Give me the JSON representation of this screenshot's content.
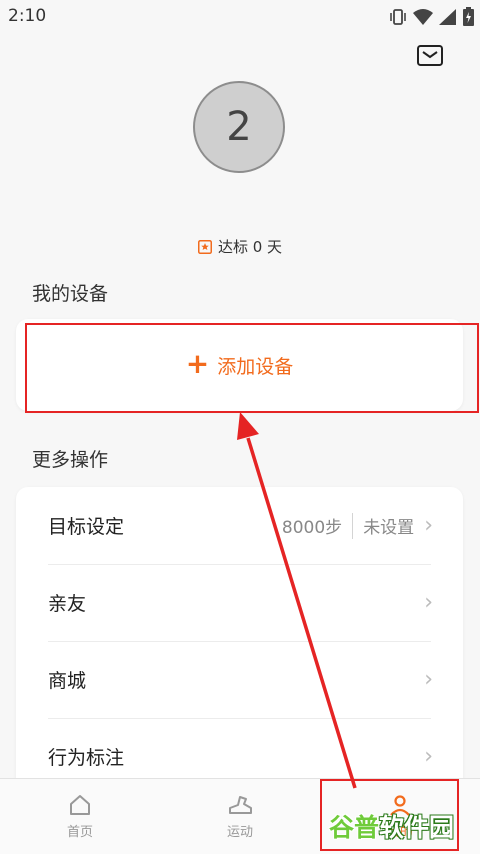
{
  "status_bar": {
    "time": "2:10",
    "icons": [
      "vibrate-icon",
      "wifi-icon",
      "signal-icon",
      "battery-icon"
    ]
  },
  "profile": {
    "avatar_text": "2",
    "goal_text": "达标 0 天"
  },
  "my_devices": {
    "title": "我的设备",
    "add_label": "添加设备"
  },
  "more_actions": {
    "title": "更多操作",
    "items": [
      {
        "label": "目标设定",
        "value": "8000步",
        "status": "未设置"
      },
      {
        "label": "亲友"
      },
      {
        "label": "商城"
      },
      {
        "label": "行为标注"
      }
    ]
  },
  "bottom_nav": {
    "items": [
      {
        "label": "首页",
        "icon": "home-icon"
      },
      {
        "label": "运动",
        "icon": "sport-icon"
      },
      {
        "label": "我的",
        "icon": "person-icon"
      }
    ]
  },
  "watermark": {
    "part1": "谷普",
    "part2": "软件园"
  },
  "colors": {
    "accent": "#f26b1d",
    "annotation": "#e52424"
  }
}
